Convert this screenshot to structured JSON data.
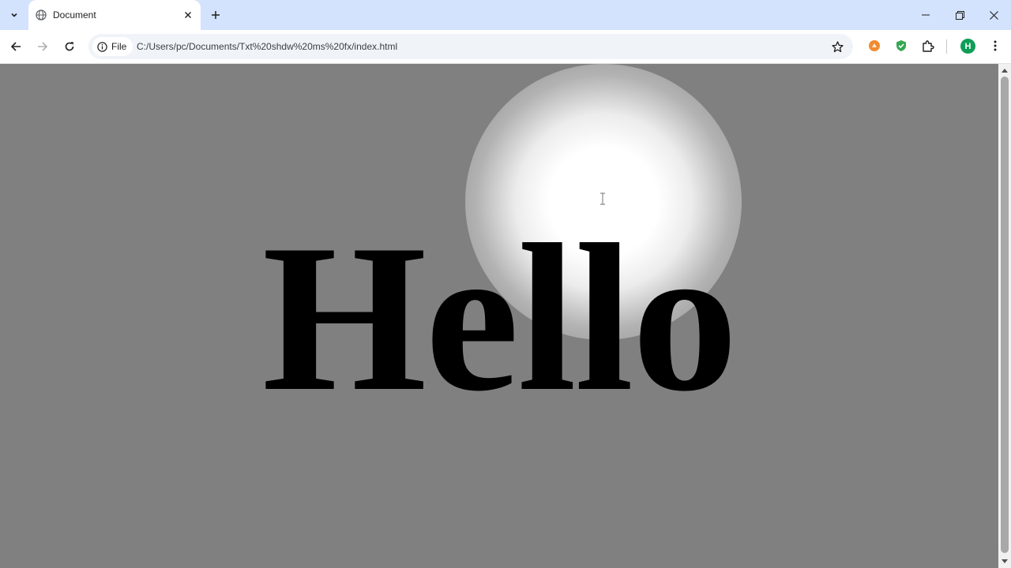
{
  "browser": {
    "tab": {
      "title": "Document",
      "favicon": "globe-icon"
    },
    "window_controls": [
      "minimize-icon",
      "restore-icon",
      "close-icon"
    ],
    "address_bar": {
      "site_label": "File",
      "url": "C:/Users/pc/Documents/Txt%20shdw%20ms%20fx/index.html"
    },
    "profile_initial": "H",
    "icons": {
      "back": "arrow-left-icon",
      "forward": "arrow-right-icon",
      "reload": "reload-icon",
      "info": "info-icon",
      "bookmark": "star-icon",
      "extension_1": "orange-extension-icon",
      "extension_2": "green-shield-icon",
      "extensions": "puzzle-icon",
      "menu": "kebab-menu-icon"
    }
  },
  "page": {
    "heading": "Hello",
    "background_color": "#808080",
    "spotlight_color": "#ffffff",
    "text_color": "#000000"
  },
  "colors": {
    "tabstrip": "#d3e3fd",
    "profile": "#0f9d58",
    "extension_orange": "#f28b30",
    "extension_green": "#34a853"
  }
}
